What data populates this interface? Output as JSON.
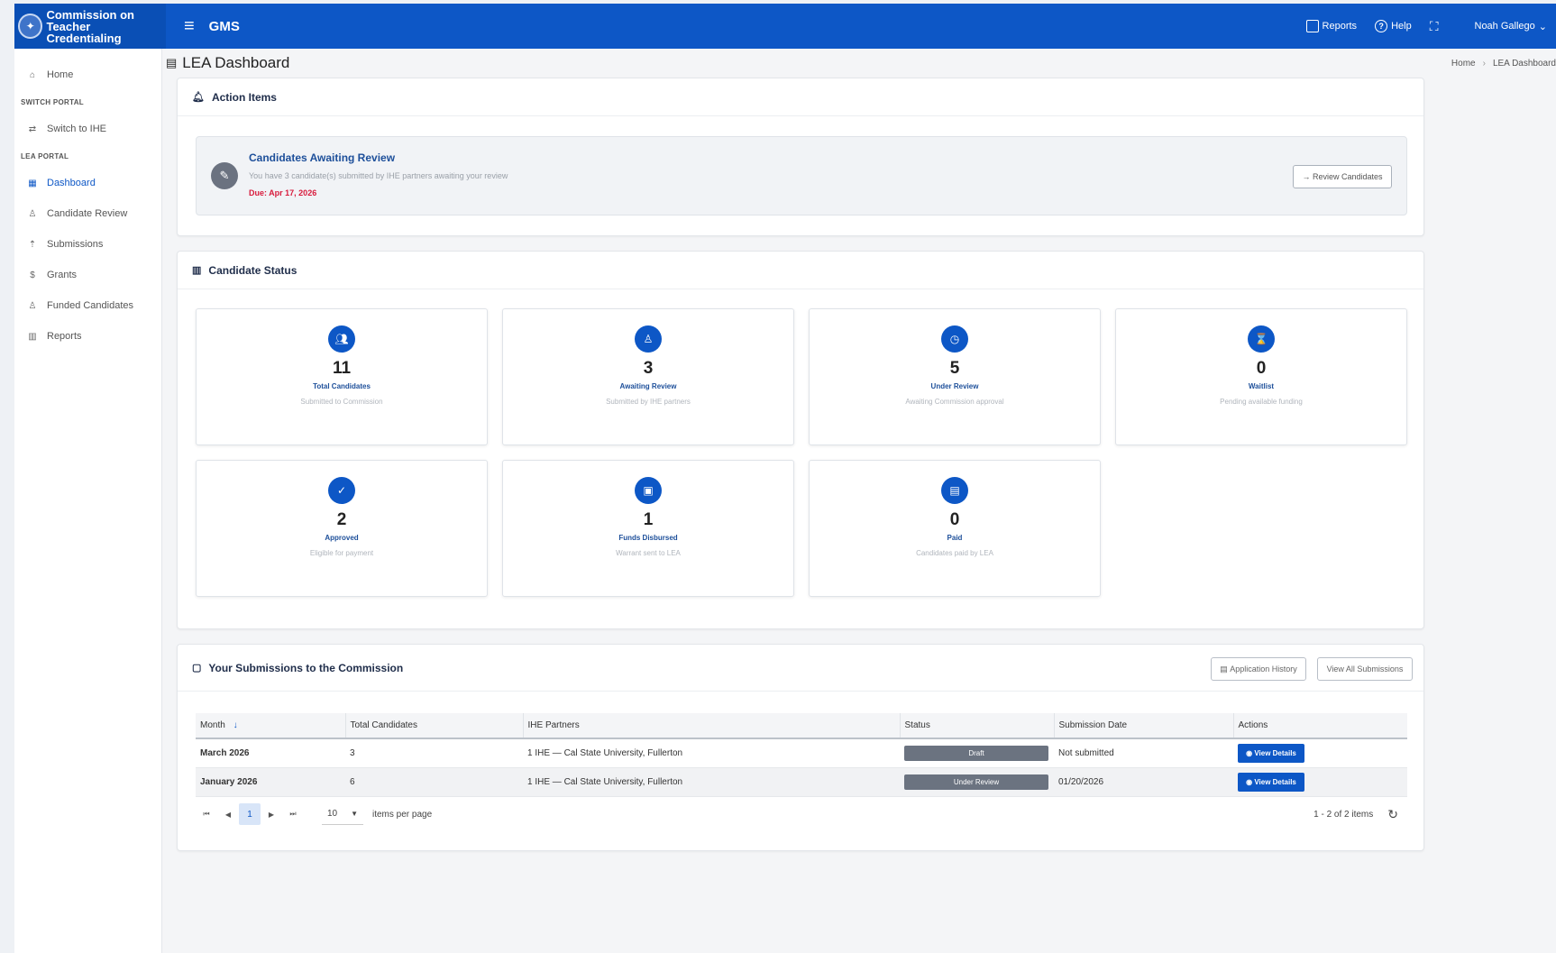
{
  "app": {
    "brand_line1": "Commission on",
    "brand_line2": "Teacher Credentialing",
    "name": "GMS"
  },
  "topbar": {
    "reports": "Reports",
    "help": "Help",
    "user": "Noah Gallego"
  },
  "sidebar": {
    "home": "Home",
    "section_switch": "SWITCH PORTAL",
    "switch_ihe": "Switch to IHE",
    "section_lea": "LEA PORTAL",
    "items": [
      {
        "label": "Dashboard",
        "icon": "grid-icon"
      },
      {
        "label": "Candidate Review",
        "icon": "user-edit-icon"
      },
      {
        "label": "Submissions",
        "icon": "upload-icon"
      },
      {
        "label": "Grants",
        "icon": "dollar-icon"
      },
      {
        "label": "Funded Candidates",
        "icon": "user-dollar-icon"
      },
      {
        "label": "Reports",
        "icon": "bar-chart-icon"
      }
    ]
  },
  "page": {
    "title": "LEA Dashboard",
    "breadcrumb": [
      "Home",
      "LEA Dashboard"
    ]
  },
  "action_items": {
    "header": "Action Items",
    "alert": {
      "title": "Candidates Awaiting Review",
      "description": "You have 3 candidate(s) submitted by IHE partners awaiting your review",
      "due": "Due: Apr 17, 2026",
      "button": "Review Candidates"
    }
  },
  "candidate_status": {
    "header": "Candidate Status",
    "tiles": [
      {
        "value": "11",
        "label": "Total Candidates",
        "sub": "Submitted to Commission",
        "icon": "users-icon"
      },
      {
        "value": "3",
        "label": "Awaiting Review",
        "sub": "Submitted by IHE partners",
        "icon": "user-review-icon"
      },
      {
        "value": "5",
        "label": "Under Review",
        "sub": "Awaiting Commission approval",
        "icon": "clock-icon"
      },
      {
        "value": "0",
        "label": "Waitlist",
        "sub": "Pending available funding",
        "icon": "waitlist-icon"
      },
      {
        "value": "2",
        "label": "Approved",
        "sub": "Eligible for payment",
        "icon": "check-icon"
      },
      {
        "value": "1",
        "label": "Funds Disbursed",
        "sub": "Warrant sent to LEA",
        "icon": "money-icon"
      },
      {
        "value": "0",
        "label": "Paid",
        "sub": "Candidates paid by LEA",
        "icon": "id-card-icon"
      }
    ]
  },
  "submissions": {
    "header": "Your Submissions to the Commission",
    "btn_history": "Application History",
    "btn_all": "View All Submissions",
    "columns": [
      "Month",
      "Total Candidates",
      "IHE Partners",
      "Status",
      "Submission Date",
      "Actions"
    ],
    "rows": [
      {
        "month": "March 2026",
        "total": "3",
        "partners": "1 IHE — Cal State University, Fullerton",
        "status": "Draft",
        "date": "Not submitted",
        "action": "View Details"
      },
      {
        "month": "January 2026",
        "total": "6",
        "partners": "1 IHE — Cal State University, Fullerton",
        "status": "Under Review",
        "date": "01/20/2026",
        "action": "View Details"
      }
    ],
    "pager": {
      "current_page": "1",
      "page_size": "10",
      "per_page_label": "items per page",
      "summary": "1 - 2 of 2 items"
    }
  },
  "colors": {
    "primary": "#0d57c6",
    "due": "#d81b3c",
    "status_pill": "#6b7380"
  }
}
